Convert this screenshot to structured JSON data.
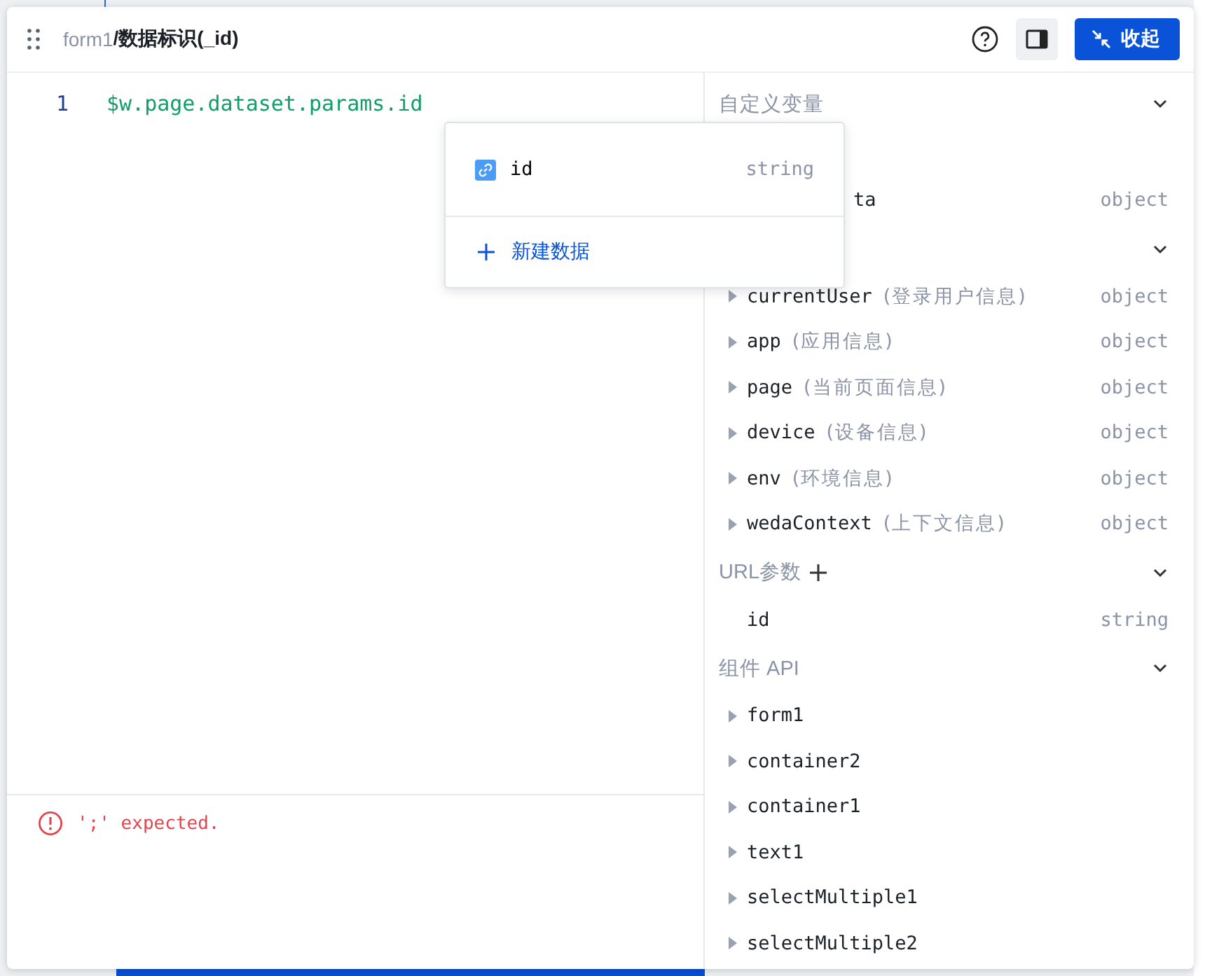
{
  "header": {
    "breadcrumb_parent": "form1",
    "breadcrumb_current": "/数据标识(_id)",
    "collapse_button": "收起"
  },
  "editor": {
    "lines": [
      {
        "number": "1",
        "code": "$w.page.dataset.params.id"
      }
    ],
    "error": "';' expected."
  },
  "suggestions": {
    "items": [
      {
        "name": "id",
        "type": "string"
      }
    ],
    "new_label": "新建数据"
  },
  "variables": {
    "sections": [
      {
        "title": "自定义变量",
        "expanded": true,
        "items": [
          {
            "name": "ta",
            "type": "object",
            "expandable": false,
            "cut": true
          }
        ]
      },
      {
        "expanded": true,
        "items": [
          {
            "name": "currentUser",
            "note": "(登录用户信息)",
            "type": "object",
            "expandable": true,
            "cut": false
          },
          {
            "name": "app",
            "note": "(应用信息)",
            "type": "object",
            "expandable": true,
            "cut": false
          },
          {
            "name": "page",
            "note": "(当前页面信息)",
            "type": "object",
            "expandable": true,
            "cut": false
          },
          {
            "name": "device",
            "note": "(设备信息)",
            "type": "object",
            "expandable": true,
            "cut": false
          },
          {
            "name": "env",
            "note": "(环境信息)",
            "type": "object",
            "expandable": true,
            "cut": false
          },
          {
            "name": "wedaContext",
            "note": "(上下文信息)",
            "type": "object",
            "expandable": true,
            "cut": false
          }
        ]
      },
      {
        "title": "URL参数",
        "expanded": true,
        "addable": true,
        "items": [
          {
            "name": "id",
            "type": "string",
            "expandable": false,
            "cut": false
          }
        ]
      },
      {
        "title": "组件 API",
        "expanded": true,
        "items": [
          {
            "name": "form1",
            "expandable": true,
            "cut": false
          },
          {
            "name": "container2",
            "expandable": true,
            "cut": false
          },
          {
            "name": "container1",
            "expandable": true,
            "cut": false
          },
          {
            "name": "text1",
            "expandable": true,
            "cut": false
          },
          {
            "name": "selectMultiple1",
            "expandable": true,
            "cut": false
          },
          {
            "name": "selectMultiple2",
            "expandable": true,
            "cut": false
          }
        ]
      }
    ]
  }
}
